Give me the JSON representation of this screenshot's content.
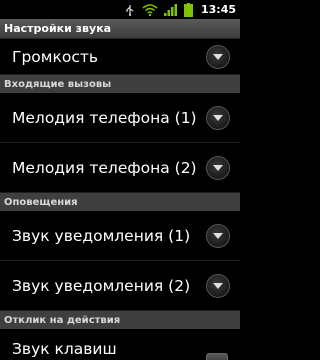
{
  "status_bar": {
    "time": "13:45",
    "icons": [
      "usb-icon",
      "wifi-icon",
      "signal-icon",
      "battery-icon"
    ]
  },
  "title": "Настройки звука",
  "items": {
    "volume": "Громкость",
    "ringtone1": "Мелодия телефона (1)",
    "ringtone2": "Мелодия телефона (2)",
    "notify1": "Звук уведомления (1)",
    "notify2": "Звук уведомления (2)",
    "key_sound": "Звук клавиш"
  },
  "sections": {
    "incoming": "Входящие вызовы",
    "notifications": "Оповещения",
    "feedback": "Отклик на действия"
  },
  "colors": {
    "accent_green": "#7ec400",
    "title_bg": "#4a4a4a",
    "section_bg": "#3f3f3f"
  }
}
